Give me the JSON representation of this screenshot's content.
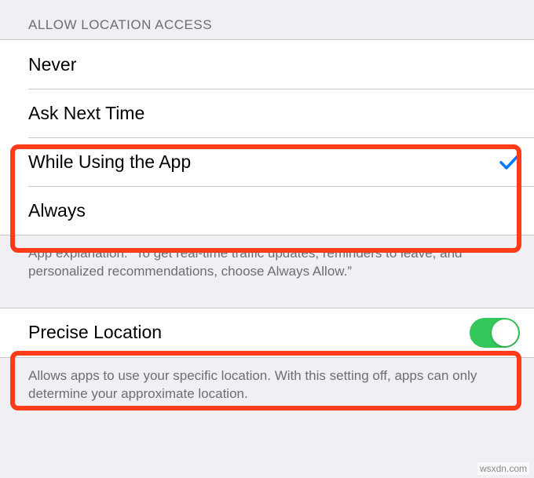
{
  "header": {
    "title": "Allow Location Access"
  },
  "options": {
    "never": "Never",
    "ask": "Ask Next Time",
    "while_using": "While Using the App",
    "always": "Always",
    "selected": "while_using"
  },
  "explanation": "App explanation: “To get real-time traffic updates, reminders to leave, and personalized recommendations, choose Always Allow.”",
  "precise": {
    "label": "Precise Location",
    "on": true,
    "footer": "Allows apps to use your specific location. With this setting off, apps can only determine your approximate location."
  },
  "colors": {
    "accent": "#007aff",
    "toggle_on": "#34c759",
    "highlight": "#ff3b1a"
  },
  "watermark": "wsxdn.com"
}
